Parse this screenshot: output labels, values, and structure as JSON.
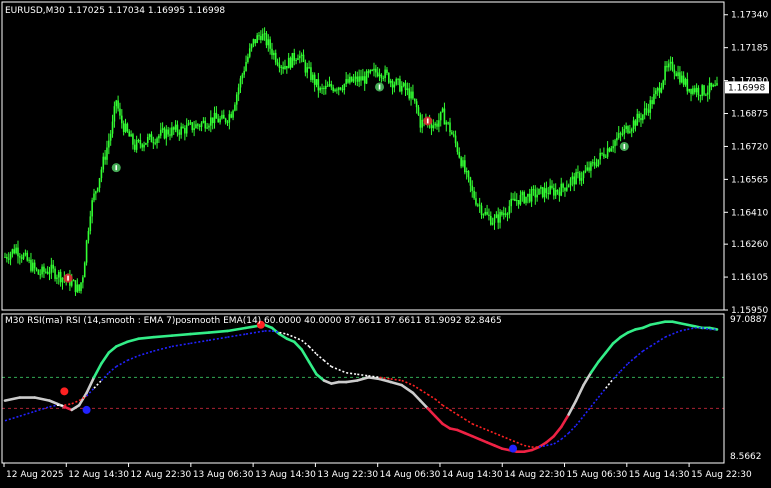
{
  "main_chart": {
    "title": "EURUSD,M30  1.17025 1.17034 1.16995 1.16998",
    "price_ticks": [
      "1.17340",
      "1.17185",
      "1.17030",
      "1.16875",
      "1.16720",
      "1.16565",
      "1.16410",
      "1.16260",
      "1.16105",
      "1.15950"
    ],
    "current_price": "1.16998",
    "colors": {
      "candle": "#33ff33",
      "background": "#000000",
      "frame": "#ffffff",
      "price_label_bg": "#ffffff"
    }
  },
  "indicator": {
    "title": "M30 RSI(ma) RSI (14,smooth : EMA  7)posmooth EMA(14) 60.0000 40.0000 87.6611 87.6611 81.9092 82.8465",
    "top_value": "97.0887",
    "bottom_value": "8.5662",
    "levels": {
      "upper": 60,
      "lower": 40
    },
    "colors": {
      "up": "#33ee88",
      "down": "#ee2244",
      "neutral": "#cccccc",
      "signal_up": "#2222ff",
      "signal_down": "#ff2222",
      "signal_white": "#ffffff"
    }
  },
  "time_axis": [
    "12 Aug 2025",
    "12 Aug 14:30",
    "12 Aug 22:30",
    "13 Aug 06:30",
    "13 Aug 14:30",
    "13 Aug 22:30",
    "14 Aug 06:30",
    "14 Aug 14:30",
    "14 Aug 22:30",
    "15 Aug 06:30",
    "15 Aug 14:30",
    "15 Aug 22:30"
  ],
  "chart_data": [
    {
      "type": "candlestick",
      "title": "EURUSD,M30",
      "ylim": [
        1.1595,
        1.174
      ],
      "x_labels": [
        "12 Aug 2025",
        "12 Aug 14:30",
        "12 Aug 22:30",
        "13 Aug 06:30",
        "13 Aug 14:30",
        "13 Aug 22:30",
        "14 Aug 06:30",
        "14 Aug 14:30",
        "14 Aug 22:30",
        "15 Aug 06:30",
        "15 Aug 14:30",
        "15 Aug 22:30"
      ],
      "close_path": [
        [
          0,
          1.162
        ],
        [
          3,
          1.1624
        ],
        [
          6,
          1.1618
        ],
        [
          9,
          1.1612
        ],
        [
          12,
          1.1614
        ],
        [
          15,
          1.1611
        ],
        [
          18,
          1.1608
        ],
        [
          20,
          1.1604
        ],
        [
          21,
          1.1612
        ],
        [
          23,
          1.1642
        ],
        [
          25,
          1.1655
        ],
        [
          27,
          1.1668
        ],
        [
          29,
          1.1682
        ],
        [
          30,
          1.1694
        ],
        [
          31,
          1.1685
        ],
        [
          33,
          1.1678
        ],
        [
          35,
          1.1672
        ],
        [
          37,
          1.1674
        ],
        [
          40,
          1.1676
        ],
        [
          44,
          1.1679
        ],
        [
          48,
          1.168
        ],
        [
          52,
          1.1682
        ],
        [
          56,
          1.1685
        ],
        [
          59,
          1.1684
        ],
        [
          61,
          1.1688
        ],
        [
          63,
          1.17
        ],
        [
          65,
          1.1712
        ],
        [
          67,
          1.1721
        ],
        [
          69,
          1.1725
        ],
        [
          71,
          1.172
        ],
        [
          73,
          1.1714
        ],
        [
          75,
          1.171
        ],
        [
          77,
          1.1712
        ],
        [
          79,
          1.1716
        ],
        [
          81,
          1.1709
        ],
        [
          83,
          1.1704
        ],
        [
          85,
          1.1698
        ],
        [
          88,
          1.17
        ],
        [
          91,
          1.1701
        ],
        [
          94,
          1.1703
        ],
        [
          97,
          1.1704
        ],
        [
          99,
          1.1706
        ],
        [
          101,
          1.1708
        ],
        [
          103,
          1.1705
        ],
        [
          105,
          1.1702
        ],
        [
          107,
          1.17
        ],
        [
          109,
          1.1697
        ],
        [
          111,
          1.169
        ],
        [
          112,
          1.1683
        ],
        [
          114,
          1.1684
        ],
        [
          116,
          1.1682
        ],
        [
          118,
          1.1687
        ],
        [
          120,
          1.168
        ],
        [
          122,
          1.1671
        ],
        [
          124,
          1.166
        ],
        [
          126,
          1.165
        ],
        [
          128,
          1.1644
        ],
        [
          130,
          1.1639
        ],
        [
          132,
          1.1637
        ],
        [
          134,
          1.164
        ],
        [
          136,
          1.1644
        ],
        [
          138,
          1.1647
        ],
        [
          140,
          1.1648
        ],
        [
          142,
          1.1649
        ],
        [
          144,
          1.165
        ],
        [
          146,
          1.1651
        ],
        [
          148,
          1.1651
        ],
        [
          150,
          1.1652
        ],
        [
          152,
          1.1655
        ],
        [
          154,
          1.1657
        ],
        [
          156,
          1.1659
        ],
        [
          158,
          1.1662
        ],
        [
          160,
          1.1666
        ],
        [
          162,
          1.167
        ],
        [
          164,
          1.1674
        ],
        [
          166,
          1.1677
        ],
        [
          168,
          1.1681
        ],
        [
          170,
          1.1684
        ],
        [
          172,
          1.1687
        ],
        [
          174,
          1.1692
        ],
        [
          176,
          1.1698
        ],
        [
          178,
          1.1707
        ],
        [
          180,
          1.171
        ],
        [
          182,
          1.1705
        ],
        [
          184,
          1.17
        ],
        [
          186,
          1.1699
        ],
        [
          188,
          1.1698
        ],
        [
          190,
          1.1699
        ],
        [
          192,
          1.1699
        ]
      ],
      "markers": [
        {
          "label": "buy-arrow",
          "x": 30,
          "value": 1.1662,
          "color": "#44aa55"
        },
        {
          "label": "sell-arrow",
          "x": 17,
          "value": 1.161,
          "color": "#cc3333"
        },
        {
          "label": "buy-arrow",
          "x": 101,
          "value": 1.17,
          "color": "#44aa55"
        },
        {
          "label": "sell-arrow",
          "x": 114,
          "value": 1.1684,
          "color": "#cc3333"
        },
        {
          "label": "buy-arrow",
          "x": 167,
          "value": 1.1672,
          "color": "#44aa55"
        }
      ]
    },
    {
      "type": "line",
      "title": "M30 RSI(ma) RSI (14,smooth : EMA  7)posmooth EMA(14)",
      "ylim": [
        8.5662,
        97.0887
      ],
      "levels": [
        60,
        40
      ],
      "series": [
        {
          "role": "rsi",
          "x": [
            0,
            4,
            8,
            12,
            14,
            16,
            18,
            20,
            22,
            24,
            26,
            28,
            30,
            33,
            36,
            40,
            45,
            50,
            55,
            60,
            65,
            70,
            72,
            74,
            76,
            78,
            80,
            82,
            84,
            86,
            88,
            90,
            92,
            95,
            98,
            101,
            104,
            107,
            110,
            112,
            114,
            116,
            118,
            120,
            122,
            124,
            126,
            128,
            130,
            132,
            134,
            136,
            138,
            140,
            142,
            144,
            146,
            148,
            150,
            152,
            154,
            156,
            158,
            160,
            162,
            164,
            166,
            168,
            170,
            172,
            174,
            176,
            178,
            180,
            182,
            184,
            186,
            188,
            190,
            192
          ],
          "y": [
            45,
            47,
            47,
            45,
            43,
            41,
            39,
            42,
            50,
            60,
            69,
            76,
            80,
            83,
            85,
            86,
            87,
            88,
            89,
            90,
            92,
            94,
            92,
            88,
            85,
            83,
            78,
            70,
            62,
            58,
            56,
            57,
            57,
            58,
            60,
            59,
            57,
            55,
            50,
            45,
            40,
            35,
            30,
            27,
            26,
            24,
            22,
            20,
            18,
            16,
            14,
            13,
            12,
            12,
            13,
            15,
            18,
            22,
            28,
            36,
            45,
            55,
            63,
            70,
            76,
            82,
            86,
            89,
            91,
            92,
            94,
            95,
            96,
            96,
            95,
            94,
            93,
            92,
            92,
            91
          ]
        },
        {
          "role": "signal",
          "x": [
            0,
            4,
            8,
            12,
            14,
            16,
            18,
            20,
            22,
            24,
            26,
            28,
            30,
            33,
            36,
            40,
            45,
            50,
            55,
            60,
            65,
            70,
            72,
            74,
            76,
            78,
            80,
            82,
            84,
            86,
            88,
            90,
            92,
            95,
            98,
            101,
            104,
            107,
            110,
            112,
            114,
            116,
            118,
            120,
            122,
            124,
            126,
            128,
            130,
            132,
            134,
            136,
            138,
            140,
            142,
            144,
            146,
            148,
            150,
            152,
            154,
            156,
            158,
            160,
            162,
            164,
            166,
            168,
            170,
            172,
            174,
            176,
            178,
            180,
            182,
            184,
            186,
            188,
            190,
            192
          ],
          "y": [
            32,
            35,
            38,
            41,
            42,
            42,
            43,
            45,
            48,
            53,
            58,
            63,
            67,
            71,
            74,
            77,
            80,
            82,
            84,
            86,
            88,
            90,
            90,
            89,
            88,
            86,
            84,
            80,
            75,
            71,
            67,
            65,
            63,
            62,
            61,
            60,
            59,
            58,
            55,
            52,
            49,
            46,
            42,
            39,
            36,
            33,
            30,
            28,
            26,
            24,
            22,
            20,
            18,
            16,
            15,
            15,
            16,
            17,
            20,
            24,
            29,
            35,
            41,
            47,
            53,
            59,
            64,
            69,
            73,
            77,
            80,
            83,
            86,
            88,
            90,
            91,
            92,
            92,
            91,
            91
          ]
        }
      ],
      "markers": [
        {
          "label": "cross",
          "x": 16,
          "value": 51,
          "color": "#ff2222"
        },
        {
          "label": "cross",
          "x": 22,
          "value": 39,
          "color": "#2222ff"
        },
        {
          "label": "cross",
          "x": 69,
          "value": 94,
          "color": "#ff2222"
        },
        {
          "label": "cross",
          "x": 137,
          "value": 14,
          "color": "#2222ff"
        }
      ]
    }
  ]
}
